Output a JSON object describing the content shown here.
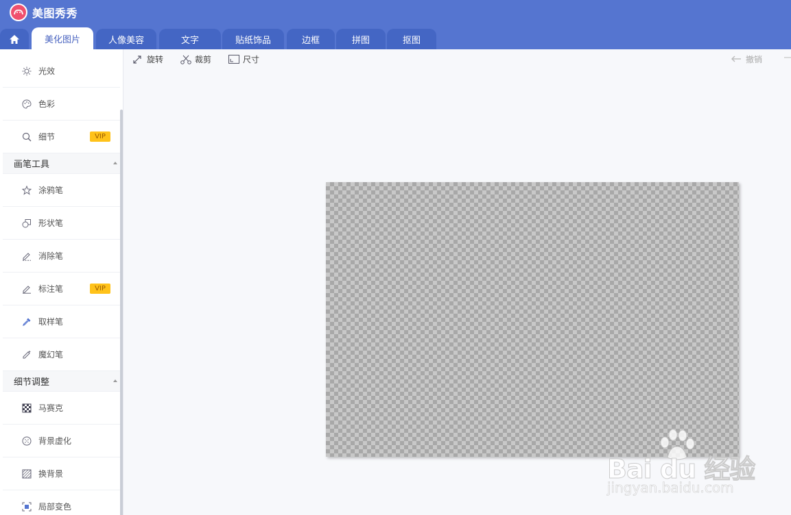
{
  "app": {
    "title": "美图秀秀"
  },
  "tabs": [
    {
      "label": "美化图片",
      "active": true
    },
    {
      "label": "人像美容"
    },
    {
      "label": "文字"
    },
    {
      "label": "贴纸饰品"
    },
    {
      "label": "边框"
    },
    {
      "label": "拼图"
    },
    {
      "label": "抠图"
    }
  ],
  "sidebar": {
    "items_top": [
      {
        "label": "光效",
        "icon": "sun-icon"
      },
      {
        "label": "色彩",
        "icon": "palette-icon"
      },
      {
        "label": "细节",
        "icon": "magnifier-icon",
        "badge": "VIP"
      }
    ],
    "section_brush": "画笔工具",
    "brush_items": [
      {
        "label": "涂鸦笔",
        "icon": "doodle-pen-icon"
      },
      {
        "label": "形状笔",
        "icon": "shape-pen-icon"
      },
      {
        "label": "消除笔",
        "icon": "eraser-pen-icon"
      },
      {
        "label": "标注笔",
        "icon": "annotate-pen-icon",
        "badge": "VIP"
      },
      {
        "label": "取样笔",
        "icon": "eyedropper-icon"
      },
      {
        "label": "魔幻笔",
        "icon": "magic-pen-icon"
      }
    ],
    "section_detail": "细节调整",
    "detail_items": [
      {
        "label": "马赛克",
        "icon": "mosaic-icon"
      },
      {
        "label": "背景虚化",
        "icon": "blur-icon"
      },
      {
        "label": "换背景",
        "icon": "change-background-icon"
      },
      {
        "label": "局部变色",
        "icon": "recolor-icon"
      }
    ]
  },
  "toolbar": {
    "rotate": "旋转",
    "crop": "裁剪",
    "size": "尺寸",
    "undo": "撤销"
  },
  "watermark": {
    "brand_text": "Bai du 经验",
    "url": "jingyan.baidu.com"
  },
  "colors": {
    "header": "#5575d0",
    "tab_inactive": "#4466c4",
    "vip": "#ffc21a"
  }
}
